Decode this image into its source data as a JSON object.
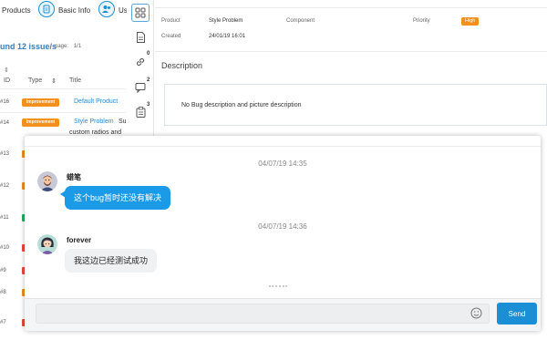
{
  "topnav": {
    "products_label": "Products",
    "basic_info_label": "Basic Info",
    "users_label_partial": "Us"
  },
  "issues": {
    "heading": "und 12 issue/s",
    "page_label": "page:",
    "page_value": "1/1",
    "columns": {
      "id": "ID",
      "type": "Type",
      "title": "Title"
    },
    "rows": [
      {
        "id": "#16",
        "type": "Improvement",
        "title": "Default Product",
        "extra": "",
        "cont": ""
      },
      {
        "id": "#14",
        "type": "Improvement",
        "title": "Style Problem",
        "extra": "Su",
        "cont": "custom radios and"
      },
      {
        "id": "#13",
        "type": "",
        "title": "",
        "extra": "",
        "cont": ""
      },
      {
        "id": "#12",
        "type": "",
        "title": "",
        "extra": "",
        "cont": ""
      },
      {
        "id": "#11",
        "type": "",
        "title": "",
        "extra": "",
        "cont": ""
      },
      {
        "id": "#10",
        "type": "",
        "title": "",
        "extra": "",
        "cont": ""
      },
      {
        "id": "#9",
        "type": "",
        "title": "",
        "extra": "",
        "cont": ""
      },
      {
        "id": "#8",
        "type": "",
        "title": "",
        "extra": "",
        "cont": ""
      },
      {
        "id": "#7",
        "type": "",
        "title": "",
        "extra": "",
        "cont": ""
      }
    ]
  },
  "iconcol": {
    "link_count": "0",
    "comment_count": "2",
    "task_count": "3"
  },
  "detail": {
    "product_label": "Product",
    "product_value": "Style Problem",
    "component_label": "Component",
    "priority_label": "Priority",
    "priority_value": "High",
    "created_label": "Created",
    "created_value": "24/01/19 16:01",
    "description_title": "Description",
    "description_text": "No Bug description and picture description"
  },
  "chat": {
    "messages": [
      {
        "time": "04/07/19 14:35",
        "sender": "蜡笔",
        "text": "这个bug暂时还没有解决",
        "avatar": "avatar-bearded-man"
      },
      {
        "time": "04/07/19 14:36",
        "sender": "forever",
        "text": "我这边已经测试成功",
        "avatar": "avatar-dark-haired-woman"
      }
    ],
    "input_value": "",
    "input_placeholder": "",
    "send_label": "Send",
    "emoji_icon": "smiley-icon"
  },
  "colors": {
    "accent": "#1a8fd6",
    "bubble_blue": "#1b9ae7",
    "badge_orange": "#f3901d",
    "badge_red": "#e74c3c",
    "badge_green": "#27ae60"
  }
}
